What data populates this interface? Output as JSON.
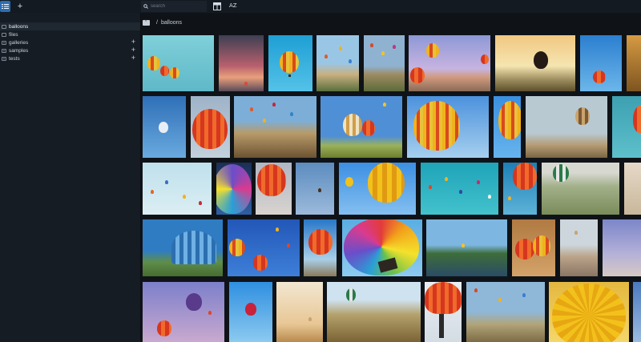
{
  "toolbar": {
    "search_placeholder": "search",
    "sort_label": "AZ",
    "add_symbol": "+"
  },
  "sidebar": {
    "items": [
      {
        "label": "balloons",
        "selected": true,
        "expandable": false
      },
      {
        "label": "files",
        "selected": false,
        "expandable": false
      },
      {
        "label": "galleries",
        "selected": false,
        "expandable": true
      },
      {
        "label": "samples",
        "selected": false,
        "expandable": true
      },
      {
        "label": "tests",
        "selected": false,
        "expandable": true
      }
    ]
  },
  "breadcrumb": {
    "separator": "/",
    "current": "balloons"
  },
  "colors": {
    "accent": "#2a6db3",
    "sidebar_bg": "#161c23",
    "main_bg": "#0f1318"
  }
}
